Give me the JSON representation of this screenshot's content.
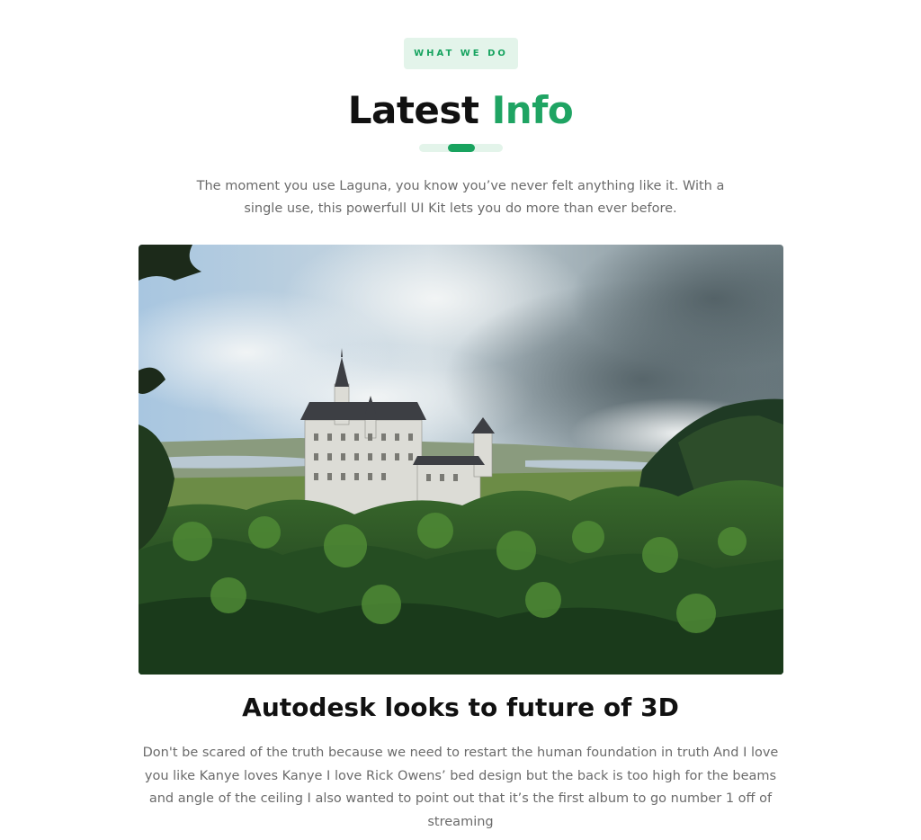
{
  "section": {
    "badge": "WHAT WE DO",
    "title_main": "Latest",
    "title_accent": "Info",
    "lead": "The moment you use Laguna, you know you’ve never felt anything like it. With a single use, this powerfull UI Kit lets you do more than ever before."
  },
  "article": {
    "headline": "Autodesk looks to future of 3D",
    "body": "Don't be scared of the truth because we need to restart the human foundation in truth And I love you like Kanye loves Kanye I love Rick Owens’ bed design but the back is too high for the beams and angle of the ceiling I also wanted to point out that it’s the first album to go number 1 off of streaming"
  },
  "colors": {
    "accent": "#1fa463",
    "badge_bg": "#e3f4ea",
    "text_muted": "#6b6b6b"
  }
}
